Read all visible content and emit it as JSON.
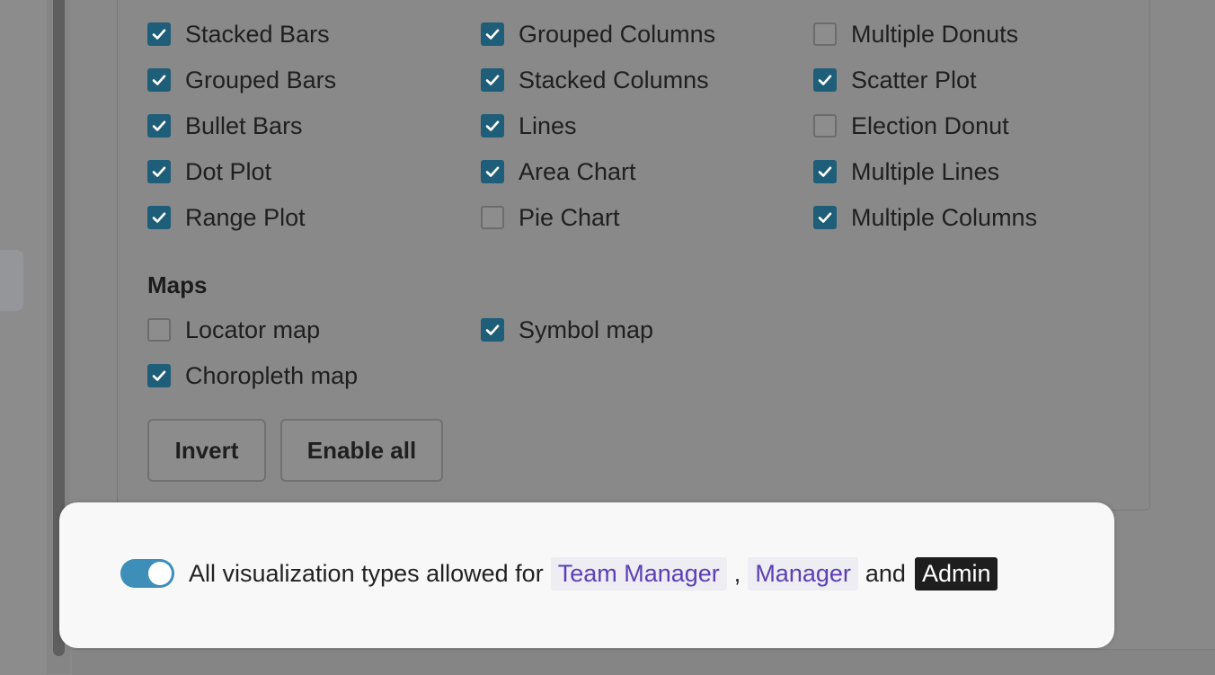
{
  "charts": {
    "col1": [
      {
        "label": "Stacked Bars",
        "checked": true
      },
      {
        "label": "Grouped Bars",
        "checked": true
      },
      {
        "label": "Bullet Bars",
        "checked": true
      },
      {
        "label": "Dot Plot",
        "checked": true
      },
      {
        "label": "Range Plot",
        "checked": true
      }
    ],
    "col2": [
      {
        "label": "Grouped Columns",
        "checked": true
      },
      {
        "label": "Stacked Columns",
        "checked": true
      },
      {
        "label": "Lines",
        "checked": true
      },
      {
        "label": "Area Chart",
        "checked": true
      },
      {
        "label": "Pie Chart",
        "checked": false
      }
    ],
    "col3": [
      {
        "label": "Multiple Donuts",
        "checked": false
      },
      {
        "label": "Scatter Plot",
        "checked": true
      },
      {
        "label": "Election Donut",
        "checked": false
      },
      {
        "label": "Multiple Lines",
        "checked": true
      },
      {
        "label": "Multiple Columns",
        "checked": true
      }
    ]
  },
  "maps": {
    "title": "Maps",
    "items": [
      {
        "label": "Locator map",
        "checked": false
      },
      {
        "label": "Symbol map",
        "checked": true
      },
      {
        "label": "Choropleth map",
        "checked": true
      }
    ]
  },
  "buttons": {
    "invert": "Invert",
    "enable_all": "Enable all"
  },
  "permission": {
    "toggle_on": true,
    "text": "All visualization types allowed for",
    "role1": "Team Manager",
    "comma": ",",
    "role2": "Manager",
    "and": "and",
    "role3": "Admin"
  },
  "colors": {
    "checkbox_checked": "#1f5e78",
    "toggle_accent": "#3d8fba",
    "role_tag_text": "#5b3fb4",
    "admin_tag_bg": "#1e1e1e"
  }
}
